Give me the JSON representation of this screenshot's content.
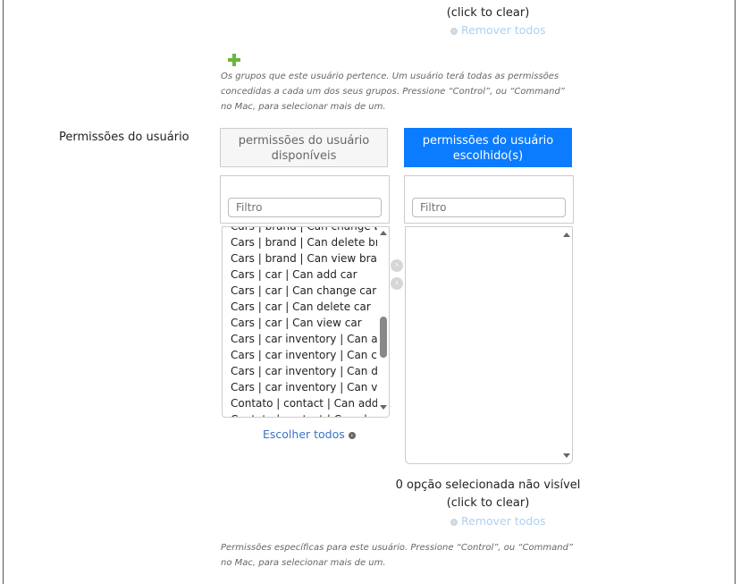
{
  "top_section": {
    "cut_text": "",
    "click_to_clear": "(click to clear)",
    "remove_all": "Remover todos"
  },
  "groups_help": "Os grupos que este usuário pertence. Um usuário terá todas as permissões concedidas a cada um dos seus grupos. Pressione “Control”, ou “Command” no Mac, para selecionar mais de um.",
  "permissions": {
    "label": "Permissões do usuário",
    "available_title": "permissões do usuário disponíveis",
    "chosen_title": "permissões do usuário escolhido(s)",
    "filter_placeholder": "Filtro",
    "available_items": [
      "Cars | brand | Can change brand",
      "Cars | brand | Can delete brand",
      "Cars | brand | Can view brand",
      "Cars | car | Can add car",
      "Cars | car | Can change car",
      "Cars | car | Can delete car",
      "Cars | car | Can view car",
      "Cars | car inventory | Can add car inventory",
      "Cars | car inventory | Can change car inventory",
      "Cars | car inventory | Can delete car inventory",
      "Cars | car inventory | Can view car inventory",
      "Contato | contact | Can add contact",
      "Contato | contact | Can change contact"
    ],
    "choose_all": "Escolher todos",
    "hidden_selected": "0 opção selecionada não visível",
    "click_to_clear": "(click to clear)",
    "remove_all": "Remover todos",
    "help": "Permissões específicas para este usuário. Pressione “Control”, ou “Command” no Mac, para selecionar mais de um."
  }
}
